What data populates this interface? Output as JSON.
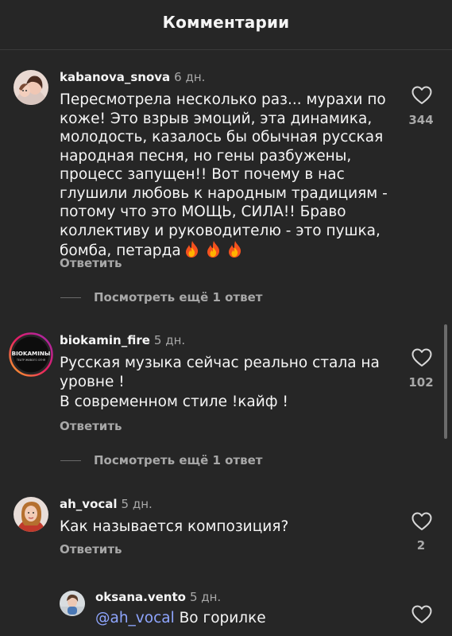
{
  "header": {
    "title": "Комментарии"
  },
  "comments": [
    {
      "username": "kabanova_snova",
      "time": "6 дн.",
      "text": "Пересмотрела несколько раз... мурахи по коже! Это взрыв эмоций, эта динамика, молодость, казалось бы обычная русская народная песня, но гены разбужены, процесс запущен!! Вот почему в нас глушили любовь к народным традициям - потому что это МОЩЬ, СИЛА!! Браво коллективу и руководителю - это пушка, бомба, петарда",
      "emojis": "🔥🔥🔥",
      "likes": "344",
      "reply_label": "Ответить",
      "view_replies": "Посмотреть ещё 1 ответ"
    },
    {
      "username": "biokamin_fire",
      "time": "5 дн.",
      "text_line1": "Русская музыка сейчас реально стала на уровне !",
      "text_line2": "В современном стиле !кайф !",
      "likes": "102",
      "reply_label": "Ответить",
      "view_replies": "Посмотреть ещё 1 ответ",
      "avatar_text": "BIOKAMINЫ",
      "avatar_subtext": "ТЕАТР ЖИВОГО ОГНЯ"
    },
    {
      "username": "ah_vocal",
      "time": "5 дн.",
      "text": "Как называется композиция?",
      "likes": "2",
      "reply_label": "Ответить"
    }
  ],
  "reply": {
    "username": "oksana.vento",
    "time": "5 дн.",
    "mention": "@ah_vocal",
    "text": " Во горилке"
  },
  "colors": {
    "background": "#262626",
    "text_primary": "#f5f5f5",
    "text_secondary": "#a8a8a8",
    "mention": "#8fa6ff"
  },
  "icons": {
    "like": "heart-outline-icon",
    "fire": "fire-emoji"
  }
}
